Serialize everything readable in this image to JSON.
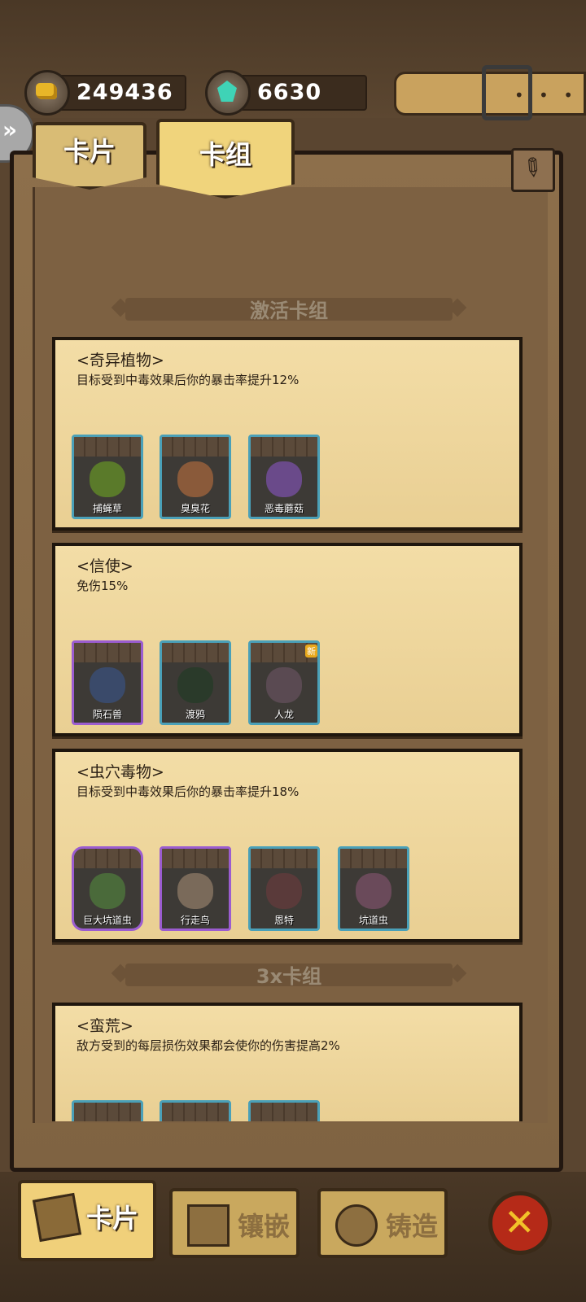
{
  "currency": {
    "gold": "249436",
    "gems": "6630"
  },
  "tabs": {
    "cards": "卡片",
    "deck": "卡组"
  },
  "sections": {
    "active": "激活卡组",
    "triple": "3x卡组"
  },
  "groups": [
    {
      "name": "<奇异植物>",
      "desc": "目标受到中毒效果后你的暴击率提升12%",
      "cards": [
        {
          "label": "捕蝇草"
        },
        {
          "label": "臭臭花"
        },
        {
          "label": "恶毒蘑菇"
        }
      ]
    },
    {
      "name": "<信使>",
      "desc": "免伤15%",
      "cards": [
        {
          "label": "陨石兽"
        },
        {
          "label": "渡鸦"
        },
        {
          "label": "人龙",
          "badge": "新"
        }
      ]
    },
    {
      "name": "<虫穴毒物>",
      "desc": "目标受到中毒效果后你的暴击率提升18%",
      "cards": [
        {
          "label": "巨大坑道虫"
        },
        {
          "label": "行走鸟"
        },
        {
          "label": "恩特"
        },
        {
          "label": "坑道虫"
        }
      ]
    },
    {
      "name": "<蛮荒>",
      "desc": "敌方受到的每层损伤效果都会使你的伤害提高2%"
    }
  ],
  "bottom": {
    "cards": "卡片",
    "inlay": "镶嵌",
    "forge": "铸造"
  },
  "colors": {
    "card_border_blue": "#4aa0b8",
    "card_border_purple": "#9b5cd0",
    "gold": "#e8b628",
    "gem": "#3fd3b6"
  }
}
